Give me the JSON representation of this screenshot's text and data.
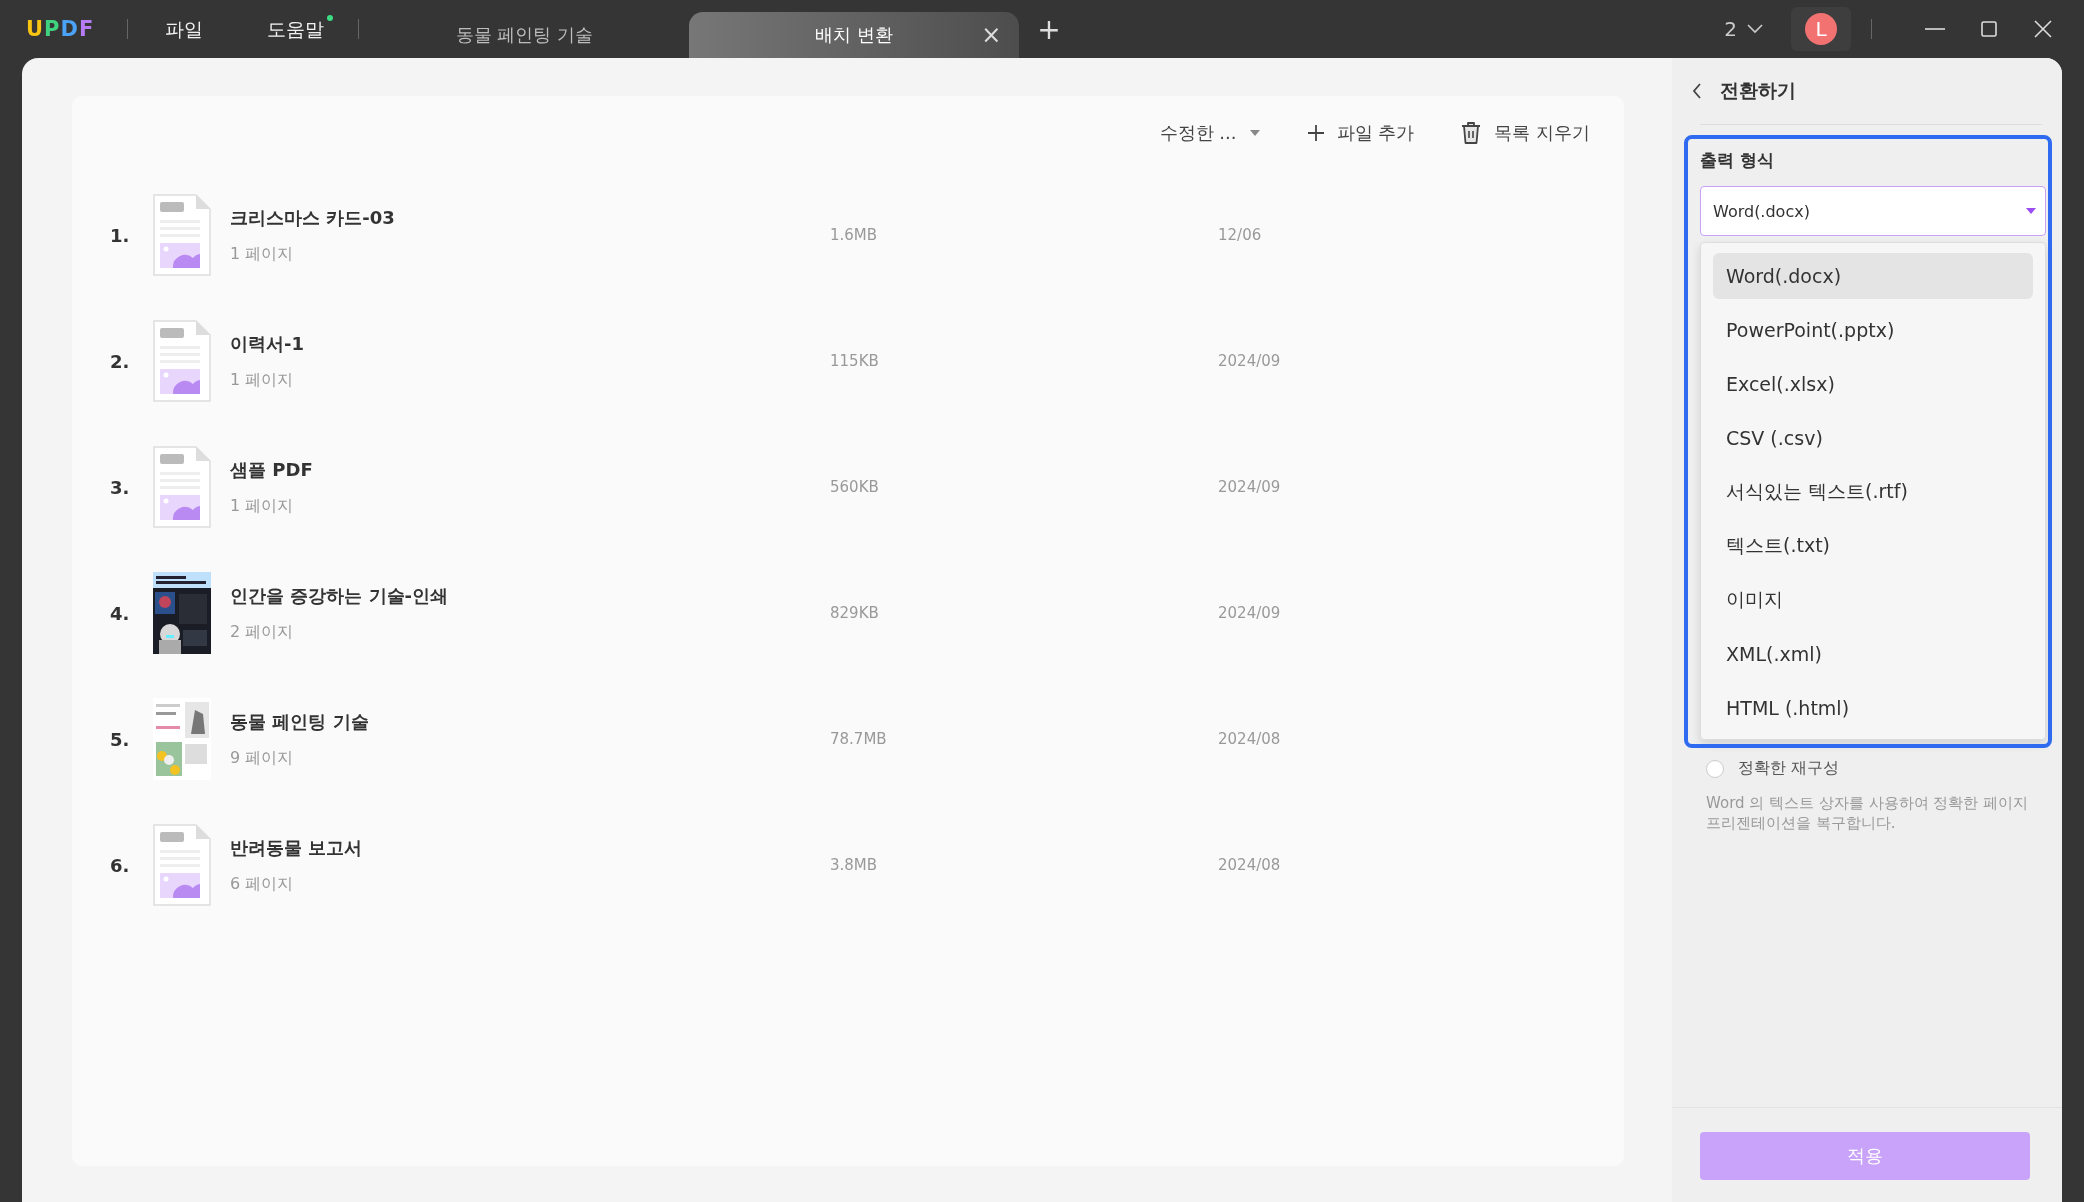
{
  "titlebar": {
    "logo": "UPDF",
    "menu": [
      {
        "label": "파일",
        "badge": false
      },
      {
        "label": "도움말",
        "badge": true
      }
    ],
    "tabs": [
      {
        "label": "동물 페인팅 기술",
        "selected": false
      },
      {
        "label": "배치 변환",
        "selected": true,
        "close": "×"
      }
    ],
    "new_tab": "+",
    "page_count": "2",
    "avatar": "L"
  },
  "toolbar": {
    "sort": "수정한 ...",
    "add_file": "파일 추가",
    "clear_list": "목록 지우기"
  },
  "files": [
    {
      "index": "1.",
      "name": "크리스마스 카드-03",
      "pages": "1 페이지",
      "size": "1.6MB",
      "date": "12/06",
      "kind": "pdf"
    },
    {
      "index": "2.",
      "name": "이력서-1",
      "pages": "1 페이지",
      "size": "115KB",
      "date": "2024/09",
      "kind": "pdf"
    },
    {
      "index": "3.",
      "name": "샘플 PDF",
      "pages": "1 페이지",
      "size": "560KB",
      "date": "2024/09",
      "kind": "pdf"
    },
    {
      "index": "4.",
      "name": "인간을 증강하는 기술-인쇄",
      "pages": "2 페이지",
      "size": "829KB",
      "date": "2024/09",
      "kind": "picture"
    },
    {
      "index": "5.",
      "name": "동물 페인팅 기술",
      "pages": "9 페이지",
      "size": "78.7MB",
      "date": "2024/08",
      "kind": "picture"
    },
    {
      "index": "6.",
      "name": "반려동물 보고서",
      "pages": "6 페이지",
      "size": "3.8MB",
      "date": "2024/08",
      "kind": "pdf"
    }
  ],
  "panel": {
    "title": "전환하기",
    "format_label": "출력 형식",
    "format_value": "Word(.docx)",
    "options": [
      {
        "label": "Word(.docx)",
        "selected": true
      },
      {
        "label": "PowerPoint(.pptx)",
        "selected": false
      },
      {
        "label": "Excel(.xlsx)",
        "selected": false
      },
      {
        "label": "CSV (.csv)",
        "selected": false
      },
      {
        "label": "서식있는 텍스트(.rtf)",
        "selected": false
      },
      {
        "label": "텍스트(.txt)",
        "selected": false
      },
      {
        "label": "이미지",
        "selected": false
      },
      {
        "label": "XML(.xml)",
        "selected": false
      },
      {
        "label": "HTML (.html)",
        "selected": false
      }
    ],
    "mode": {
      "label": "정확한 재구성",
      "selected": false
    },
    "description": "Word 의 텍스트 상자를 사용하여 정확한 페이지 프리젠테이션을 복구합니다.",
    "apply": "적용"
  }
}
